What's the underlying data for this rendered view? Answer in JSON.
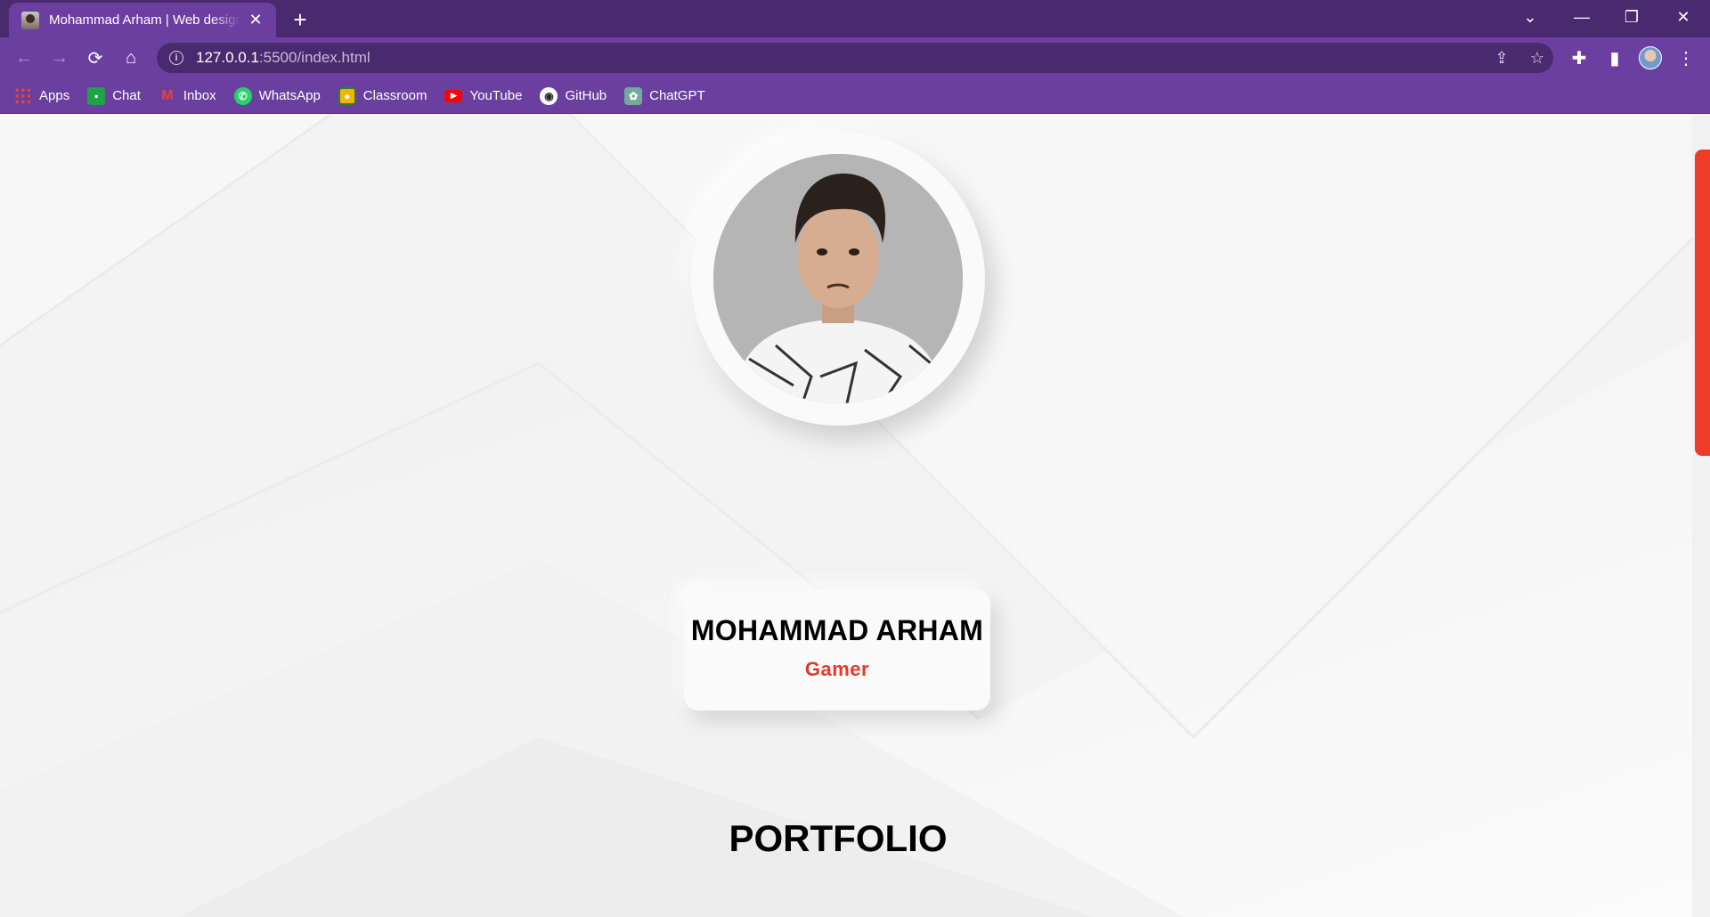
{
  "browser": {
    "tab": {
      "title": "Mohammad Arham | Web designer"
    },
    "address": {
      "host": "127.0.0.1",
      "path": ":5500/index.html"
    },
    "bookmarks": [
      {
        "label": "Apps",
        "icon": "apps-grid-icon",
        "color": "#4285f4"
      },
      {
        "label": "Chat",
        "icon": "google-chat-icon",
        "color": "#1ea446"
      },
      {
        "label": "Inbox",
        "icon": "gmail-icon",
        "color": "#ea4335"
      },
      {
        "label": "WhatsApp",
        "icon": "whatsapp-icon",
        "color": "#25d366"
      },
      {
        "label": "Classroom",
        "icon": "classroom-icon",
        "color": "#f4b400"
      },
      {
        "label": "YouTube",
        "icon": "youtube-icon",
        "color": "#ff0000"
      },
      {
        "label": "GitHub",
        "icon": "github-icon",
        "color": "#24292e"
      },
      {
        "label": "ChatGPT",
        "icon": "chatgpt-icon",
        "color": "#74aa9c"
      }
    ],
    "theme": {
      "frame": "#4a2a6f",
      "toolbar": "#6b3fa0"
    }
  },
  "profile": {
    "name": "MOHAMMAD ARHAM",
    "role": "Gamer",
    "accent": "#e03a2c"
  },
  "sections": {
    "portfolio_title": "PORTFOLIO"
  }
}
